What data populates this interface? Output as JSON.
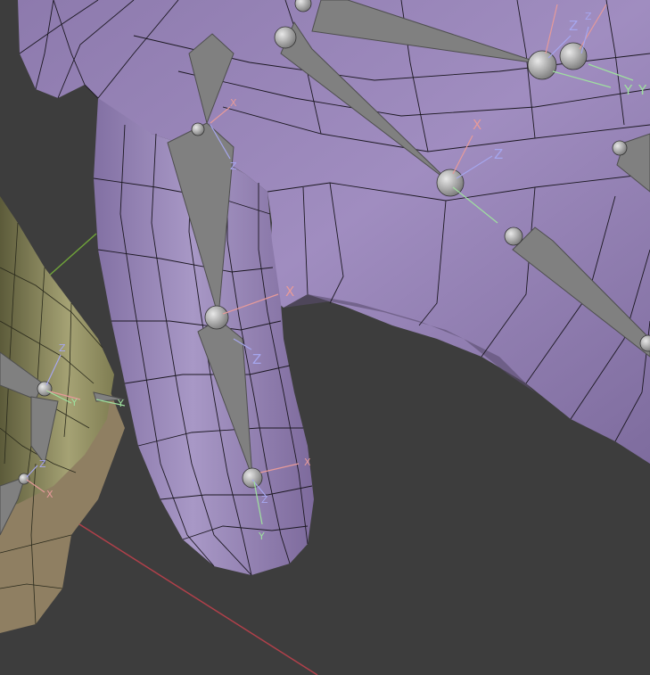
{
  "viewport": {
    "background": "#3d3d3d",
    "grid_x_axis_color": "#b0404a",
    "grid_y_axis_color": "#6fa33a"
  },
  "mesh": {
    "hand_fill": "#9582b3",
    "hand_edge": "#1c1822",
    "arm_fill": "#8c8a5a",
    "arm_light": "#a8a678",
    "brown_fill": "#8f7f62"
  },
  "bones": {
    "fill": "#808080",
    "dark": "#4e4e4e",
    "joint": "#b0b0b0"
  },
  "axis_colors": {
    "x": "#e69a9a",
    "y": "#9fe09f",
    "z": "#a6a6ee"
  },
  "axes_labels": {
    "x": "X",
    "y": "Y",
    "z": "Z"
  }
}
